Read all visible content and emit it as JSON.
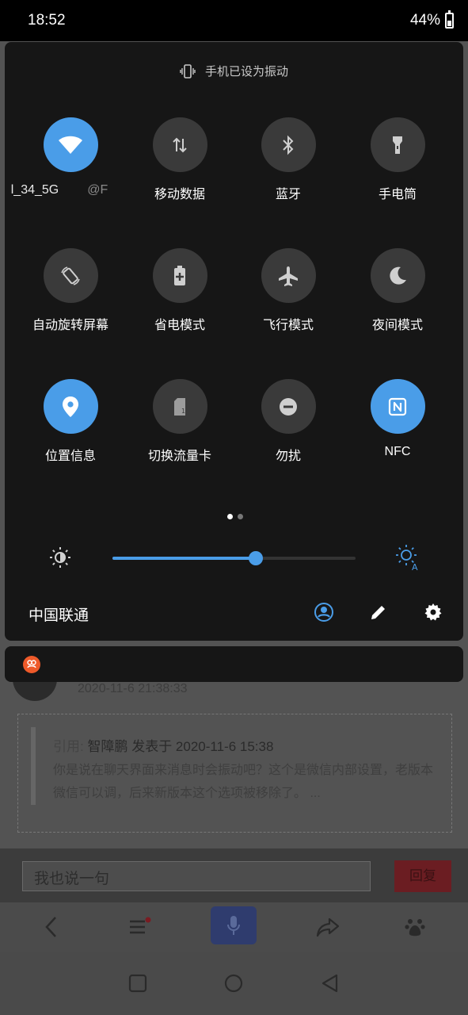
{
  "status_bar": {
    "time": "18:52",
    "battery": "44%",
    "battery_fraction": 0.44
  },
  "quick_settings": {
    "header": "手机已设为振动",
    "tiles": [
      {
        "label_a": "l_34_5G",
        "label_b": "@F",
        "icon": "wifi-icon",
        "on": true
      },
      {
        "label": "移动数据",
        "icon": "mobile-data-icon",
        "on": false
      },
      {
        "label": "蓝牙",
        "icon": "bluetooth-icon",
        "on": false
      },
      {
        "label": "手电筒",
        "icon": "flashlight-icon",
        "on": false
      },
      {
        "label": "自动旋转屏幕",
        "icon": "auto-rotate-icon",
        "on": false
      },
      {
        "label": "省电模式",
        "icon": "battery-saver-icon",
        "on": false
      },
      {
        "label": "飞行模式",
        "icon": "airplane-icon",
        "on": false
      },
      {
        "label": "夜间模式",
        "icon": "moon-icon",
        "on": false
      },
      {
        "label": "位置信息",
        "icon": "location-icon",
        "on": true
      },
      {
        "label": "切换流量卡",
        "icon": "sim-card-icon",
        "on": false
      },
      {
        "label": "勿扰",
        "icon": "do-not-disturb-icon",
        "on": false
      },
      {
        "label": "NFC",
        "icon": "nfc-icon",
        "on": true
      }
    ],
    "page_count": 2,
    "current_page": 1,
    "brightness_level": 0.59,
    "carrier": "中国联通",
    "accent_color": "#4a9de8"
  },
  "background_page": {
    "post_date": "2020-11-6 21:38:33",
    "quote_prefix": "引用:",
    "quote_author": "智障鹏 发表于 2020-11-6 15:38",
    "quote_body": "你是说在聊天界面来消息时会振动吧？这个是微信内部设置，老版本微信可以调，后来新版本这个选项被移除了。 ...",
    "reply_placeholder": "我也说一句",
    "reply_button": "回复"
  }
}
